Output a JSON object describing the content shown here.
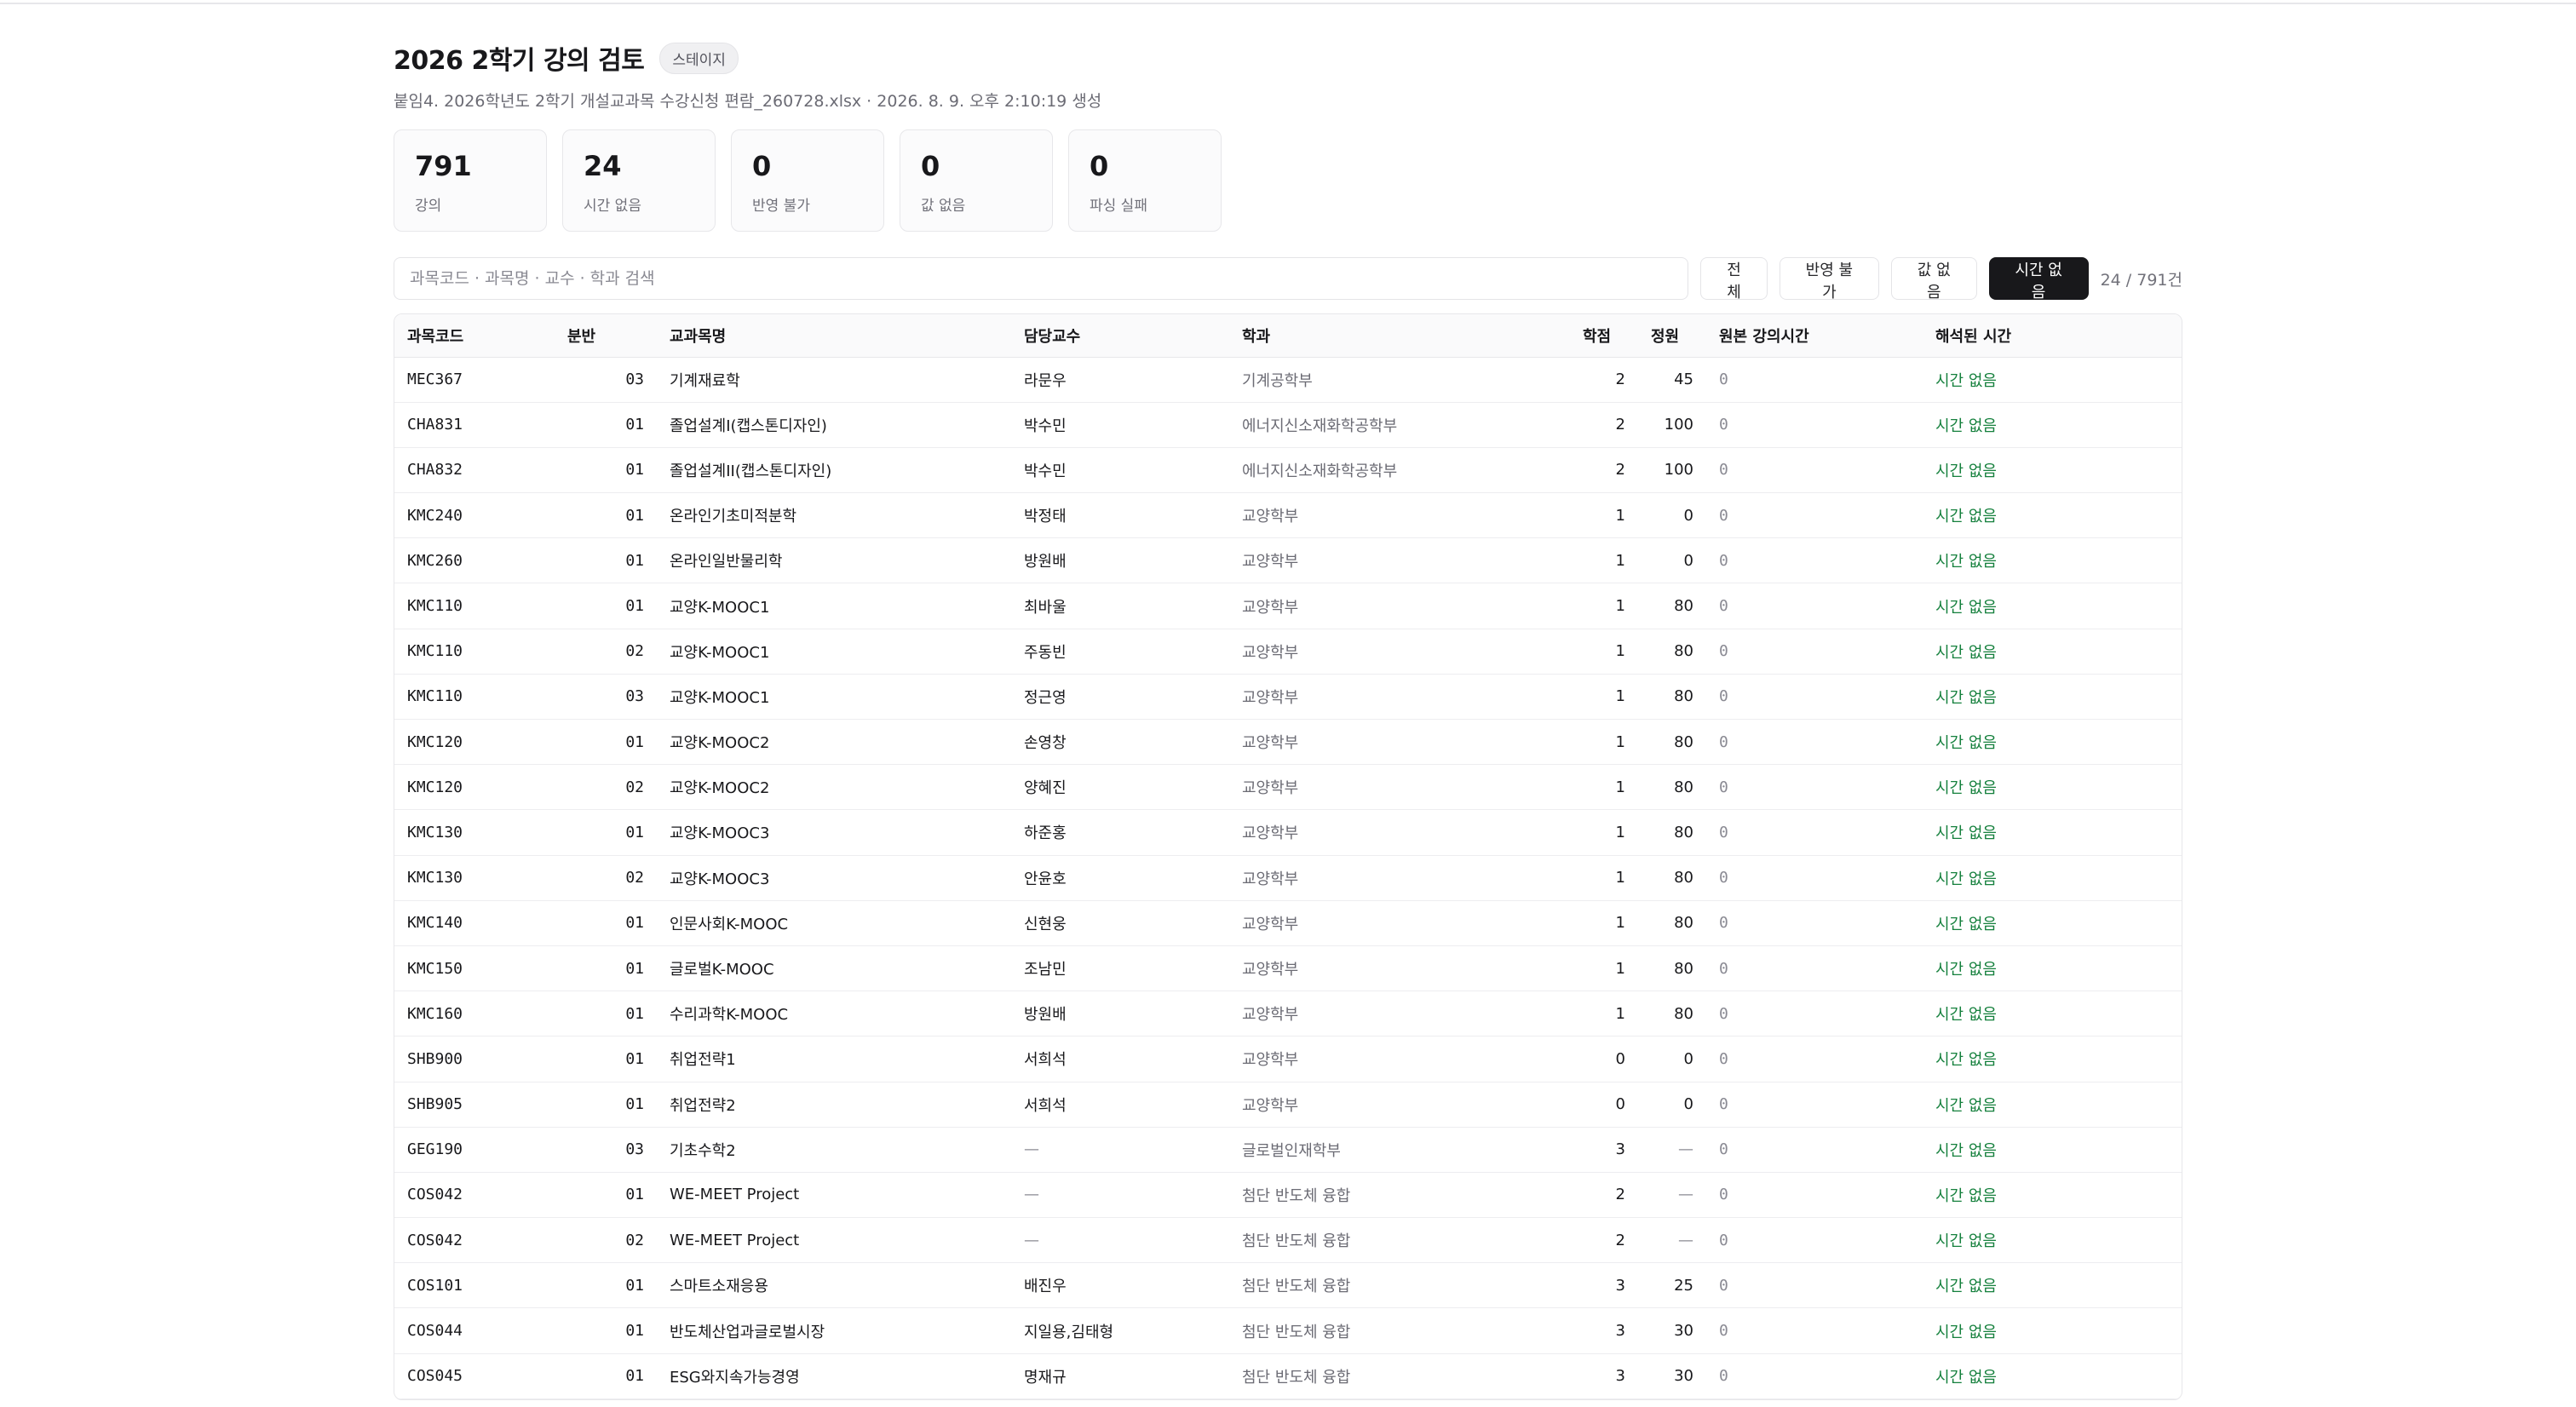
{
  "header": {
    "title": "2026 2학기 강의 검토",
    "badge": "스테이지",
    "subtitle": "붙임4. 2026학년도 2학기 개설교과목 수강신청 편람_260728.xlsx · 2026. 8. 9. 오후 2:10:19 생성"
  },
  "stats": [
    {
      "value": "791",
      "label": "강의"
    },
    {
      "value": "24",
      "label": "시간 없음"
    },
    {
      "value": "0",
      "label": "반영 불가"
    },
    {
      "value": "0",
      "label": "값 없음"
    },
    {
      "value": "0",
      "label": "파싱 실패"
    }
  ],
  "toolbar": {
    "search_placeholder": "과목코드 · 과목명 · 교수 · 학과 검색",
    "search_value": "",
    "filters": [
      "전체",
      "반영 불가",
      "값 없음",
      "시간 없음"
    ],
    "active_filter": "시간 없음",
    "count": "24 / 791건"
  },
  "table": {
    "columns": [
      "과목코드",
      "분반",
      "교과목명",
      "담당교수",
      "학과",
      "학점",
      "정원",
      "원본 강의시간",
      "해석된 시간"
    ],
    "rows": [
      {
        "code": "MEC367",
        "section": "03",
        "name": "기계재료학",
        "prof": "라문우",
        "dept": "기계공학부",
        "credit": "2",
        "cap": "45",
        "raw": "0",
        "parsed": "시간 없음"
      },
      {
        "code": "CHA831",
        "section": "01",
        "name": "졸업설계I(캡스톤디자인)",
        "prof": "박수민",
        "dept": "에너지신소재화학공학부",
        "credit": "2",
        "cap": "100",
        "raw": "0",
        "parsed": "시간 없음"
      },
      {
        "code": "CHA832",
        "section": "01",
        "name": "졸업설계II(캡스톤디자인)",
        "prof": "박수민",
        "dept": "에너지신소재화학공학부",
        "credit": "2",
        "cap": "100",
        "raw": "0",
        "parsed": "시간 없음"
      },
      {
        "code": "KMC240",
        "section": "01",
        "name": "온라인기초미적분학",
        "prof": "박정태",
        "dept": "교양학부",
        "credit": "1",
        "cap": "0",
        "raw": "0",
        "parsed": "시간 없음"
      },
      {
        "code": "KMC260",
        "section": "01",
        "name": "온라인일반물리학",
        "prof": "방원배",
        "dept": "교양학부",
        "credit": "1",
        "cap": "0",
        "raw": "0",
        "parsed": "시간 없음"
      },
      {
        "code": "KMC110",
        "section": "01",
        "name": "교양K-MOOC1",
        "prof": "최바울",
        "dept": "교양학부",
        "credit": "1",
        "cap": "80",
        "raw": "0",
        "parsed": "시간 없음"
      },
      {
        "code": "KMC110",
        "section": "02",
        "name": "교양K-MOOC1",
        "prof": "주동빈",
        "dept": "교양학부",
        "credit": "1",
        "cap": "80",
        "raw": "0",
        "parsed": "시간 없음"
      },
      {
        "code": "KMC110",
        "section": "03",
        "name": "교양K-MOOC1",
        "prof": "정근영",
        "dept": "교양학부",
        "credit": "1",
        "cap": "80",
        "raw": "0",
        "parsed": "시간 없음"
      },
      {
        "code": "KMC120",
        "section": "01",
        "name": "교양K-MOOC2",
        "prof": "손영창",
        "dept": "교양학부",
        "credit": "1",
        "cap": "80",
        "raw": "0",
        "parsed": "시간 없음"
      },
      {
        "code": "KMC120",
        "section": "02",
        "name": "교양K-MOOC2",
        "prof": "양혜진",
        "dept": "교양학부",
        "credit": "1",
        "cap": "80",
        "raw": "0",
        "parsed": "시간 없음"
      },
      {
        "code": "KMC130",
        "section": "01",
        "name": "교양K-MOOC3",
        "prof": "하준홍",
        "dept": "교양학부",
        "credit": "1",
        "cap": "80",
        "raw": "0",
        "parsed": "시간 없음"
      },
      {
        "code": "KMC130",
        "section": "02",
        "name": "교양K-MOOC3",
        "prof": "안윤호",
        "dept": "교양학부",
        "credit": "1",
        "cap": "80",
        "raw": "0",
        "parsed": "시간 없음"
      },
      {
        "code": "KMC140",
        "section": "01",
        "name": "인문사회K-MOOC",
        "prof": "신현웅",
        "dept": "교양학부",
        "credit": "1",
        "cap": "80",
        "raw": "0",
        "parsed": "시간 없음"
      },
      {
        "code": "KMC150",
        "section": "01",
        "name": "글로벌K-MOOC",
        "prof": "조남민",
        "dept": "교양학부",
        "credit": "1",
        "cap": "80",
        "raw": "0",
        "parsed": "시간 없음"
      },
      {
        "code": "KMC160",
        "section": "01",
        "name": "수리과학K-MOOC",
        "prof": "방원배",
        "dept": "교양학부",
        "credit": "1",
        "cap": "80",
        "raw": "0",
        "parsed": "시간 없음"
      },
      {
        "code": "SHB900",
        "section": "01",
        "name": "취업전략1",
        "prof": "서희석",
        "dept": "교양학부",
        "credit": "0",
        "cap": "0",
        "raw": "0",
        "parsed": "시간 없음"
      },
      {
        "code": "SHB905",
        "section": "01",
        "name": "취업전략2",
        "prof": "서희석",
        "dept": "교양학부",
        "credit": "0",
        "cap": "0",
        "raw": "0",
        "parsed": "시간 없음"
      },
      {
        "code": "GEG190",
        "section": "03",
        "name": "기초수학2",
        "prof": "—",
        "dept": "글로벌인재학부",
        "credit": "3",
        "cap": "—",
        "raw": "0",
        "parsed": "시간 없음"
      },
      {
        "code": "COS042",
        "section": "01",
        "name": "WE-MEET Project",
        "prof": "—",
        "dept": "첨단 반도체 융합",
        "credit": "2",
        "cap": "—",
        "raw": "0",
        "parsed": "시간 없음"
      },
      {
        "code": "COS042",
        "section": "02",
        "name": "WE-MEET Project",
        "prof": "—",
        "dept": "첨단 반도체 융합",
        "credit": "2",
        "cap": "—",
        "raw": "0",
        "parsed": "시간 없음"
      },
      {
        "code": "COS101",
        "section": "01",
        "name": "스마트소재응용",
        "prof": "배진우",
        "dept": "첨단 반도체 융합",
        "credit": "3",
        "cap": "25",
        "raw": "0",
        "parsed": "시간 없음"
      },
      {
        "code": "COS044",
        "section": "01",
        "name": "반도체산업과글로벌시장",
        "prof": "지일용,김태형",
        "dept": "첨단 반도체 융합",
        "credit": "3",
        "cap": "30",
        "raw": "0",
        "parsed": "시간 없음"
      },
      {
        "code": "COS045",
        "section": "01",
        "name": "ESG와지속가능경영",
        "prof": "명재규",
        "dept": "첨단 반도체 융합",
        "credit": "3",
        "cap": "30",
        "raw": "0",
        "parsed": "시간 없음"
      }
    ]
  },
  "colors": {
    "accent": "#18181b",
    "status_green": "#15803d"
  }
}
